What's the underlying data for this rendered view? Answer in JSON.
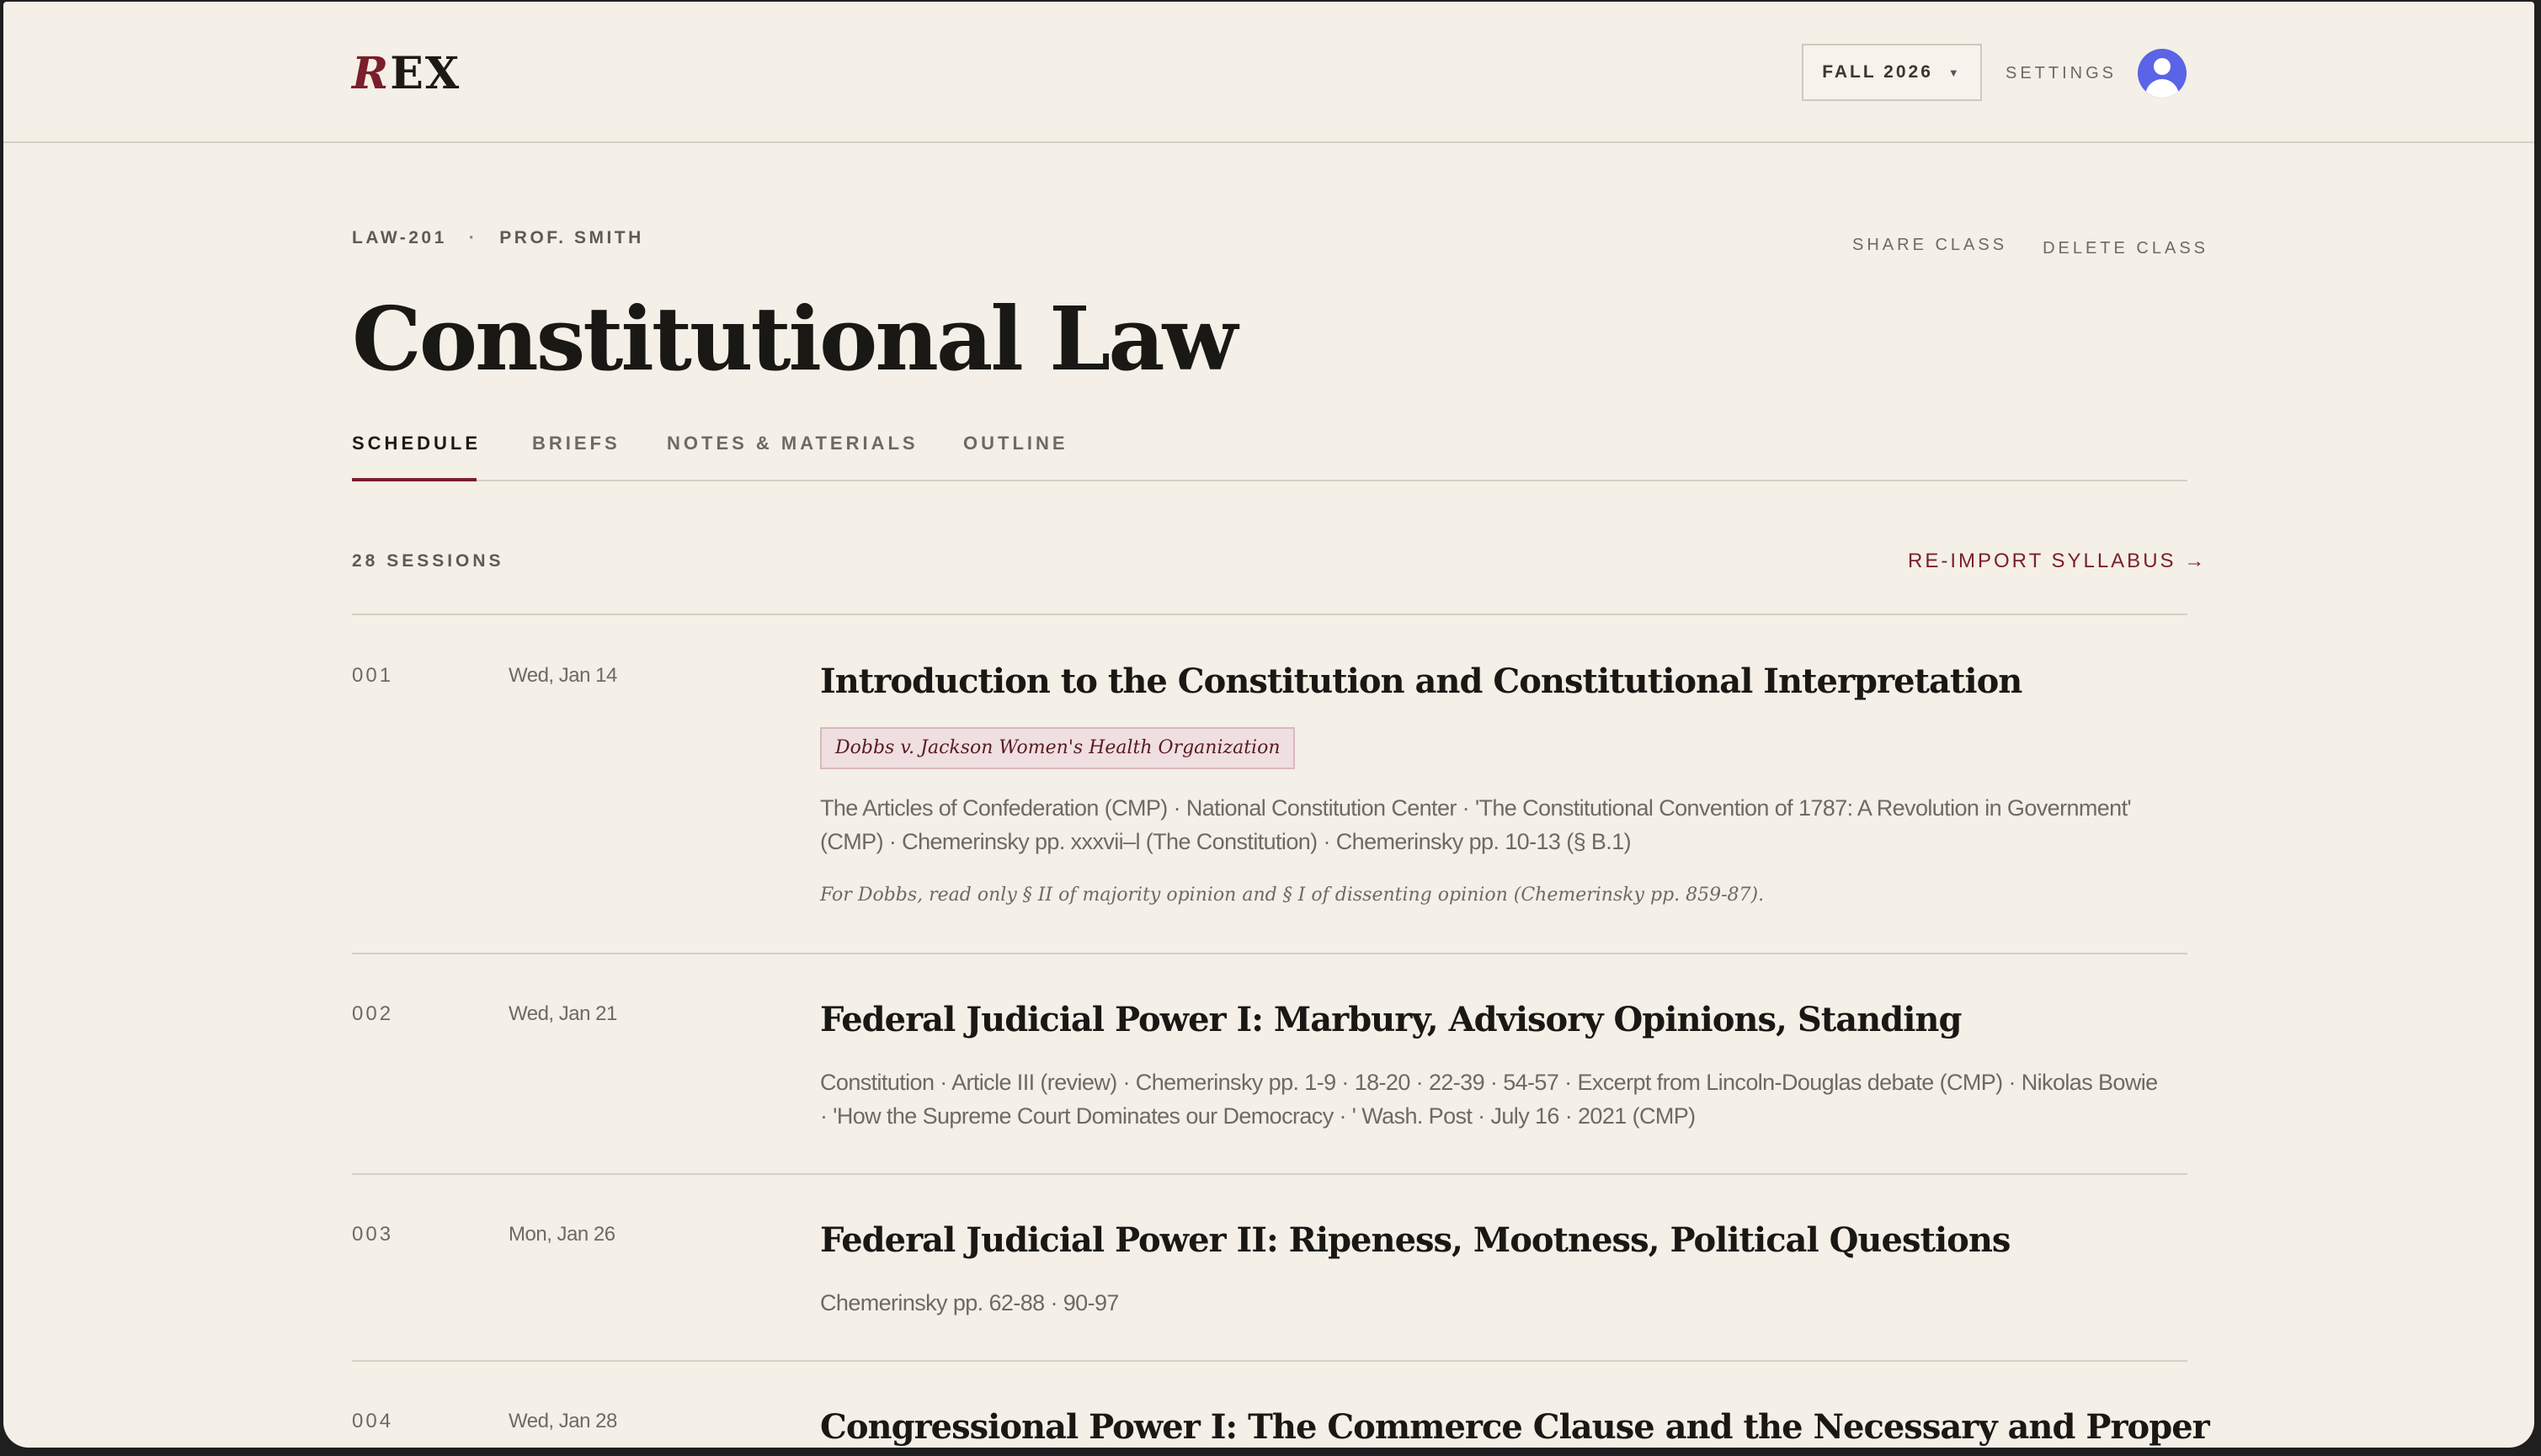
{
  "app": {
    "logo_r": "R",
    "logo_rest": "EX",
    "term": "FALL 2026",
    "settings": "SETTINGS"
  },
  "course": {
    "code": "LAW-201",
    "separator": "·",
    "professor": "PROF. SMITH",
    "title": "Constitutional Law",
    "share": "SHARE CLASS",
    "delete": "DELETE CLASS"
  },
  "tabs": [
    {
      "label": "SCHEDULE",
      "active": true
    },
    {
      "label": "BRIEFS",
      "active": false
    },
    {
      "label": "NOTES & MATERIALS",
      "active": false
    },
    {
      "label": "OUTLINE",
      "active": false
    }
  ],
  "schedule": {
    "count": "28 SESSIONS",
    "reimport": "RE-IMPORT SYLLABUS →",
    "sessions": [
      {
        "num": "001",
        "date": "Wed, Jan 14",
        "title": "Introduction to the Constitution and Constitutional Interpretation",
        "case": "Dobbs v. Jackson Women's Health Organization",
        "readings": "The Articles of Confederation (CMP) · National Constitution Center · 'The Constitutional Convention of 1787: A Revolution in Government' (CMP) · Chemerinsky pp. xxxvii–l (The Constitution) · Chemerinsky pp. 10-13 (§ B.1)",
        "note": "For Dobbs, read only § II of majority opinion and § I of dissenting opinion (Chemerinsky pp. 859-87)."
      },
      {
        "num": "002",
        "date": "Wed, Jan 21",
        "title": "Federal Judicial Power I: Marbury, Advisory Opinions, Standing",
        "readings": "Constitution · Article III (review) · Chemerinsky pp. 1-9 · 18-20 · 22-39 · 54-57 · Excerpt from Lincoln-Douglas debate (CMP) · Nikolas Bowie · 'How the Supreme Court Dominates our Democracy · ' Wash. Post · July 16 · 2021 (CMP)"
      },
      {
        "num": "003",
        "date": "Mon, Jan 26",
        "title": "Federal Judicial Power II: Ripeness, Mootness, Political Questions",
        "readings": "Chemerinsky pp. 62-88 · 90-97"
      },
      {
        "num": "004",
        "date": "Wed, Jan 28",
        "title": "Congressional Power I: The Commerce Clause and the Necessary and Proper"
      }
    ]
  }
}
